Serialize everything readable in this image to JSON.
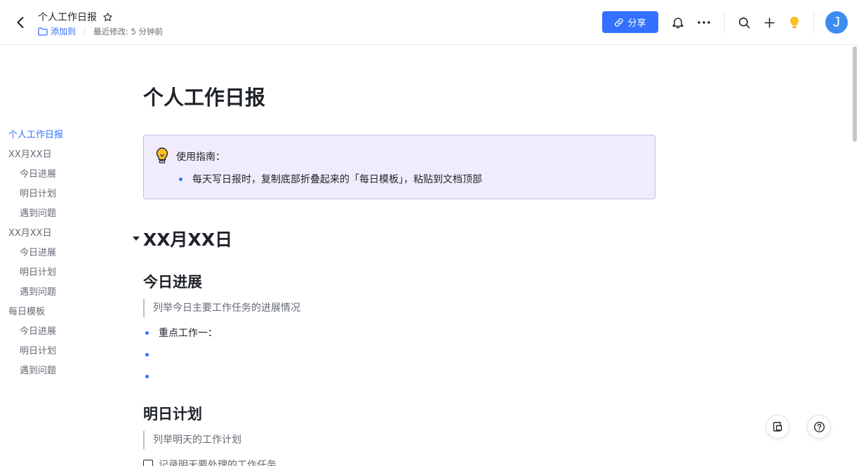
{
  "header": {
    "doc_title": "个人工作日报",
    "add_to_label": "添加到",
    "last_modified": "最近修改: 5 分钟前",
    "share_label": "分享",
    "avatar_letter": "J",
    "accent_color": "#3370ff",
    "icons": [
      "back-icon",
      "star-icon",
      "folder-icon",
      "link-icon",
      "bell-icon",
      "more-icon",
      "search-icon",
      "plus-icon",
      "bulb-icon"
    ]
  },
  "outline": {
    "items": [
      {
        "label": "个人工作日报",
        "level": 1,
        "active": true
      },
      {
        "label": "XX月XX日",
        "level": 1
      },
      {
        "label": "今日进展",
        "level": 2
      },
      {
        "label": "明日计划",
        "level": 2
      },
      {
        "label": "遇到问题",
        "level": 2
      },
      {
        "label": "XX月XX日",
        "level": 1
      },
      {
        "label": "今日进展",
        "level": 2
      },
      {
        "label": "明日计划",
        "level": 2
      },
      {
        "label": "遇到问题",
        "level": 2
      },
      {
        "label": "每日模板",
        "level": 1
      },
      {
        "label": "今日进展",
        "level": 2
      },
      {
        "label": "明日计划",
        "level": 2
      },
      {
        "label": "遇到问题",
        "level": 2
      }
    ]
  },
  "doc": {
    "title": "个人工作日报",
    "callout": {
      "heading": "使用指南：",
      "bullet": "每天写日报时，复制底部折叠起来的「每日模板」，粘贴到文档顶部"
    },
    "section_heading": "XX月XX日",
    "progress": {
      "heading": "今日进展",
      "quote": "列举今日主要工作任务的进展情况",
      "bullets": [
        "重点工作一：",
        "",
        ""
      ]
    },
    "plan": {
      "heading": "明日计划",
      "quote": "列举明天的工作计划",
      "todo": "记录明天要处理的工作任务"
    }
  }
}
